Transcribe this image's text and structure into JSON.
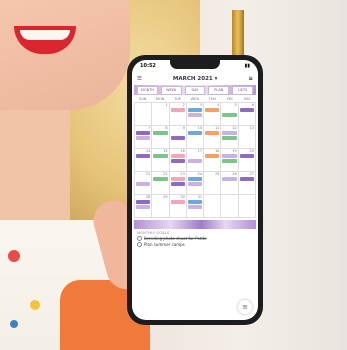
{
  "status": {
    "time": "10:52"
  },
  "app": {
    "month": "MARCH",
    "year": "2021"
  },
  "tabs": [
    "MONTH",
    "WEEK",
    "DAY",
    "PLAN",
    "LISTS"
  ],
  "dow": [
    "SUN",
    "MON",
    "TUE",
    "WED",
    "THU",
    "FRI",
    "SAT"
  ],
  "days": [
    "",
    "1",
    "2",
    "3",
    "4",
    "5",
    "6",
    "7",
    "8",
    "9",
    "10",
    "11",
    "12",
    "13",
    "14",
    "15",
    "16",
    "17",
    "18",
    "19",
    "20",
    "21",
    "22",
    "23",
    "24",
    "25",
    "26",
    "27",
    "28",
    "29",
    "30",
    "31",
    "",
    "",
    ""
  ],
  "goals": {
    "heading": "MONTHLY GOALS",
    "items": [
      {
        "text": "Brending photo shoot for Petite",
        "done": true
      },
      {
        "text": "Plan summer camps",
        "done": false
      }
    ]
  },
  "colors": {
    "accent": "#8e6bbf",
    "lipstick": "#d9262f"
  }
}
